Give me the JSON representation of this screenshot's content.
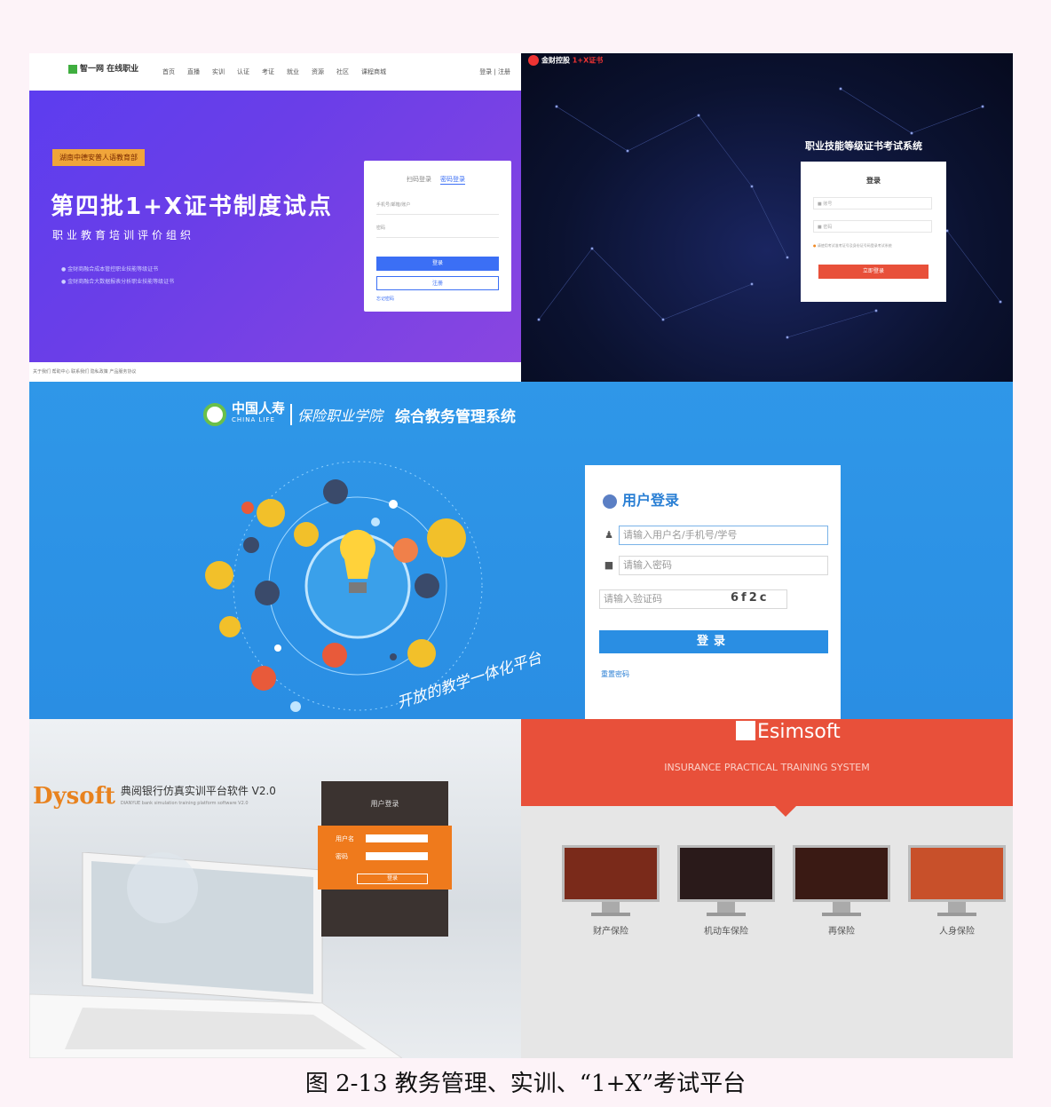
{
  "caption": "图 2-13 教务管理、实训、“1+X”考试平台",
  "panel1": {
    "logo": "智一网 在线职业",
    "nav": [
      "首页",
      "直播",
      "实训",
      "认证",
      "考证",
      "就业",
      "资源",
      "社区",
      "课程商城"
    ],
    "login_link": "登录 | 注册",
    "badge": "湖南中德安普人语教育部",
    "title": "第四批1+X证书制度试点",
    "subtitle": "职业教育培训评价组织",
    "bullets": [
      "● 金财商融合成本管控职业技能等级证书",
      "● 金财商融合大数据报表分析职业技能等级证书"
    ],
    "tabs": [
      "扫码登录",
      "密码登录"
    ],
    "username_placeholder": "手机号/邮箱/账户",
    "password_placeholder": "密码",
    "login_button": "登录",
    "register_button": "注册",
    "forgot": "忘记密码",
    "footer": "关于我们   帮助中心   联系我们   隐私政策   产品服务协议"
  },
  "panel2": {
    "brand": "金财控股",
    "brand_hl": "1+X证书",
    "system": "职业技能等级证书考试系统",
    "heading": "登录",
    "username_placeholder": "账号",
    "password_placeholder": "密码",
    "note": "请使用考试准考证号及身份证号码登录考试系统",
    "button": "立即登录"
  },
  "panel3": {
    "company": "中国人寿",
    "company_en": "CHINA LIFE",
    "script": "保险职业学院",
    "system": "综合教务管理系统",
    "heading": "用户登录",
    "username_placeholder": "请输入用户名/手机号/学号",
    "password_placeholder": "请输入密码",
    "captcha_placeholder": "请输入验证码",
    "captcha": "6f2c",
    "button": "登录",
    "reset": "重置密码",
    "slogan": "开放的教学一体化平台"
  },
  "panel4": {
    "brand": "Dysoft",
    "product": "典阅银行仿真实训平台软件 V2.0",
    "product_en": "DIANYUE bank simulation training platform software V2.0",
    "login_title": "用户登录",
    "user_label": "用户名",
    "pass_label": "密码",
    "button": "登录"
  },
  "panel5": {
    "logo": "Esimsoft",
    "subtitle": "INSURANCE PRACTICAL TRAINING SYSTEM",
    "modules": [
      "财产保险",
      "机动车保险",
      "再保险",
      "人身保险"
    ]
  },
  "colors": {
    "p1_bg": "#6a3ee8",
    "p2_bg": "#0b1230",
    "p3_bg": "#2a8ee3",
    "p4_accent": "#ef7a1c",
    "p5_accent": "#e8503a"
  }
}
